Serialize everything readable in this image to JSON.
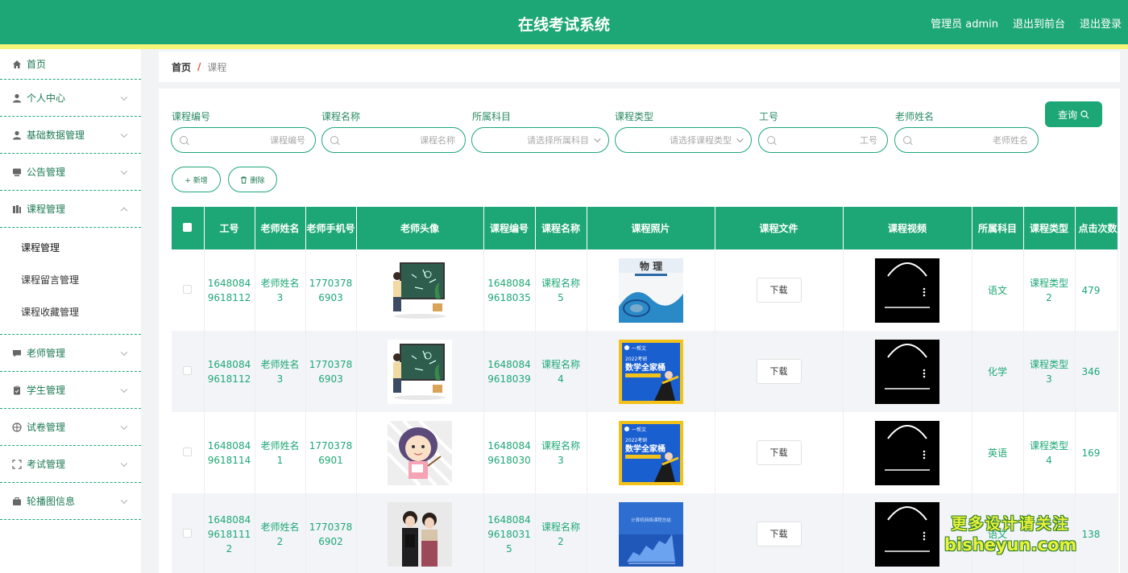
{
  "header": {
    "title": "在线考试系统",
    "admin_label": "管理员 admin",
    "to_front": "退出到前台",
    "logout": "退出登录"
  },
  "sidebar": {
    "items": [
      {
        "label": "首页",
        "icon": "home-icon"
      },
      {
        "label": "个人中心",
        "icon": "user-icon"
      },
      {
        "label": "基础数据管理",
        "icon": "users-icon"
      },
      {
        "label": "公告管理",
        "icon": "notice-icon"
      },
      {
        "label": "课程管理",
        "icon": "book-icon",
        "expanded": true
      },
      {
        "label": "老师管理",
        "icon": "chat-icon"
      },
      {
        "label": "学生管理",
        "icon": "clipboard-icon"
      },
      {
        "label": "试卷管理",
        "icon": "target-icon"
      },
      {
        "label": "考试管理",
        "icon": "frame-icon"
      },
      {
        "label": "轮播图信息",
        "icon": "briefcase-icon"
      }
    ],
    "sub_items": [
      "课程管理",
      "课程留言管理",
      "课程收藏管理"
    ]
  },
  "breadcrumb": {
    "home": "首页",
    "separator": "/",
    "current": "课程"
  },
  "filters": [
    {
      "label": "课程编号",
      "placeholder": "课程编号",
      "type": "text"
    },
    {
      "label": "课程名称",
      "placeholder": "课程名称",
      "type": "text"
    },
    {
      "label": "所属科目",
      "placeholder": "请选择所属科目",
      "type": "select"
    },
    {
      "label": "课程类型",
      "placeholder": "请选择课程类型",
      "type": "select"
    },
    {
      "label": "工号",
      "placeholder": "工号",
      "type": "text"
    },
    {
      "label": "老师姓名",
      "placeholder": "老师姓名",
      "type": "text"
    }
  ],
  "actions": {
    "search": "查询",
    "add": "+ 新增",
    "delete": "删除"
  },
  "table": {
    "headers": [
      "工号",
      "老师姓名",
      "老师手机号",
      "老师头像",
      "课程编号",
      "课程名称",
      "课程照片",
      "课程文件",
      "课程视频",
      "所属科目",
      "课程类型",
      "点击次数"
    ],
    "download_label": "下载",
    "rows": [
      {
        "staff_no": "1648084\n9618112",
        "teacher": "老师姓名\n3",
        "phone": "1770378\n6903",
        "avatar": "teacher-blackboard",
        "course_no": "1648084\n9618035",
        "course_name": "课程名称\n5",
        "photo": "physics-book",
        "subject": "语文",
        "course_type": "课程类型\n2",
        "clicks": "479"
      },
      {
        "staff_no": "1648084\n9618112",
        "teacher": "老师姓名\n3",
        "phone": "1770378\n6903",
        "avatar": "teacher-blackboard",
        "course_no": "1648084\n9618039",
        "course_name": "课程名称\n4",
        "photo": "math-book",
        "subject": "化学",
        "course_type": "课程类型\n3",
        "clicks": "346"
      },
      {
        "staff_no": "1648084\n9618114",
        "teacher": "老师姓名\n1",
        "phone": "1770378\n6901",
        "avatar": "cartoon-teacher",
        "course_no": "1648084\n9618030",
        "course_name": "课程名称\n3",
        "photo": "math-book",
        "subject": "英语",
        "course_type": "课程类型\n4",
        "clicks": "169"
      },
      {
        "staff_no": "1648084\n9618111\n2",
        "teacher": "老师姓名\n2",
        "phone": "1770378\n6902",
        "avatar": "teacher-photo",
        "course_no": "1648084\n9618031\n5",
        "course_name": "课程名称\n2",
        "photo": "computer-book",
        "subject": "语文",
        "course_type": "",
        "clicks": "138"
      }
    ]
  },
  "photo_texts": {
    "physics_title": "物 理",
    "math_badge": "一帮文",
    "math_year": "2022考研",
    "math_title": "数学全家桶",
    "computer_title": "计算机网络课程总结"
  },
  "watermark": {
    "line1": "更多设计请关注",
    "line2": "bisheyun.com"
  }
}
